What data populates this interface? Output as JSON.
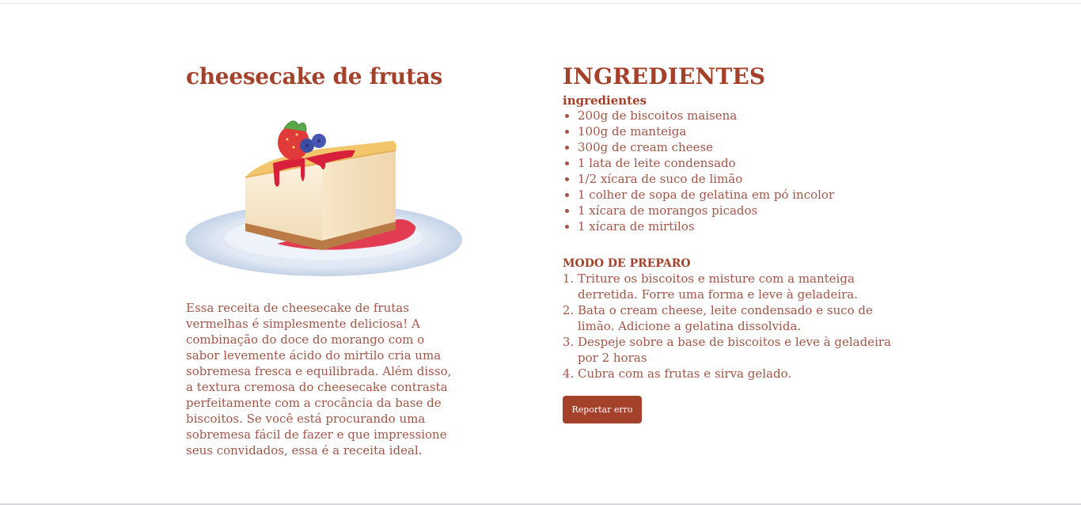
{
  "recipe": {
    "title": "cheesecake de frutas",
    "image_subject": "cheesecake-slice-illustration",
    "description": "Essa receita de cheesecake de frutas vermelhas é simplesmente deliciosa! A combinação do doce do morango com o sabor levemente ácido do mirtilo cria uma sobremesa fresca e equilibrada. Além disso, a textura cremosa do cheesecake contrasta perfeitamente com a crocância da base de biscoitos. Se você está procurando uma sobremesa fácil de fazer e que impressione seus convidados, essa é a receita ideal."
  },
  "ingredients": {
    "heading": "INGREDIENTES",
    "subheading": "ingredientes",
    "items": [
      "200g de biscoitos maisena",
      "100g de manteiga",
      "300g de cream cheese",
      "1 lata de leite condensado",
      "1/2 xícara de suco de limão",
      "1 colher de sopa de gelatina em pó incolor",
      "1 xícara de morangos picados",
      "1 xícara de mirtilos"
    ]
  },
  "method": {
    "heading": "MODO DE PREPARO",
    "steps": [
      "Triture os biscoitos e misture com a manteiga derretida. Forre uma forma e leve à geladeira.",
      "Bata o cream cheese, leite condensado e suco de limão. Adicione a gelatina dissolvida.",
      "Despeje sobre a base de biscoitos e leve à geladeira por 2 horas",
      "Cubra com as frutas e sirva gelado."
    ]
  },
  "actions": {
    "report_label": "Reportar erro"
  },
  "colors": {
    "accent": "#a3412a",
    "text": "#a35545",
    "button_text": "#ffffff"
  }
}
